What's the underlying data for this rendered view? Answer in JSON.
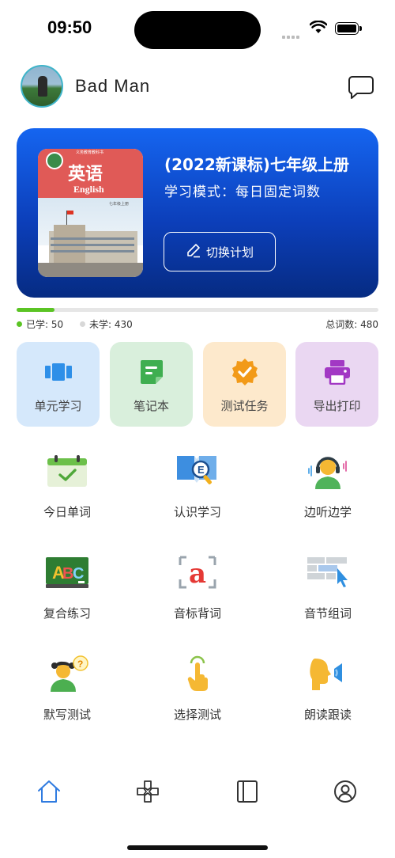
{
  "status_bar": {
    "time": "09:50"
  },
  "header": {
    "username": "Bad  Man"
  },
  "plan": {
    "book_title_cn": "英语",
    "book_title_en": "English",
    "title": "(2022新课标)七年级上册",
    "mode": "学习模式：每日固定词数",
    "switch_label": "切换计划"
  },
  "progress": {
    "learned_label": "已学: 50",
    "unlearned_label": "未学: 430",
    "total_label": "总词数: 480",
    "learned": 50,
    "total": 480,
    "color_learned": "#5bc424",
    "color_unlearned": "#d8d8d8"
  },
  "quick_tiles": [
    {
      "label": "单元学习",
      "icon": "unit-study-icon",
      "bg": "#d5e8fb",
      "color": "#2e8fe8"
    },
    {
      "label": "笔记本",
      "icon": "notebook-icon",
      "bg": "#d9efdc",
      "color": "#3fae50"
    },
    {
      "label": "测试任务",
      "icon": "test-task-badge-icon",
      "bg": "#fde9cc",
      "color": "#f29a18"
    },
    {
      "label": "导出打印",
      "icon": "printer-icon",
      "bg": "#ead7f2",
      "color": "#a238c4"
    }
  ],
  "features": [
    {
      "label": "今日单词",
      "icon": "calendar-check-icon"
    },
    {
      "label": "认识学习",
      "icon": "book-magnifier-icon"
    },
    {
      "label": "边听边学",
      "icon": "headphones-person-icon"
    },
    {
      "label": "复合练习",
      "icon": "abc-blackboard-icon"
    },
    {
      "label": "音标背词",
      "icon": "phonetic-a-icon"
    },
    {
      "label": "音节组词",
      "icon": "syllable-blocks-icon"
    },
    {
      "label": "默写测试",
      "icon": "thinking-person-icon"
    },
    {
      "label": "选择测试",
      "icon": "tap-hand-icon"
    },
    {
      "label": "朗读跟读",
      "icon": "speaking-head-icon"
    }
  ],
  "tab_bar": [
    {
      "name": "home",
      "icon": "home-icon",
      "active": true
    },
    {
      "name": "game",
      "icon": "gamepad-icon",
      "active": false
    },
    {
      "name": "book",
      "icon": "book-icon",
      "active": false
    },
    {
      "name": "profile",
      "icon": "user-icon",
      "active": false
    }
  ]
}
